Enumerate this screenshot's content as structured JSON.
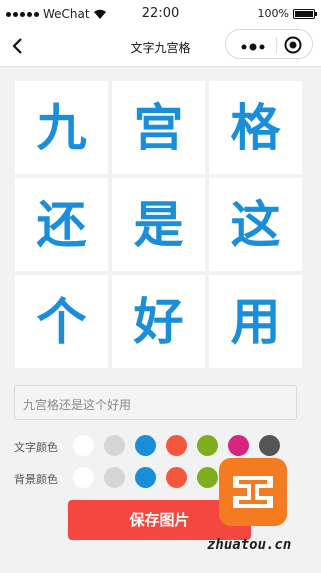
{
  "status_bar": {
    "carrier": "WeChat",
    "time": "22:00",
    "battery": "100%",
    "battery_level": 1.0
  },
  "nav": {
    "title": "文字九宫格",
    "back_icon": "chevron-left-icon",
    "more_icon": "more-dots-icon",
    "close_icon": "target-circle-icon"
  },
  "grid": {
    "text_color": "#1a8ed8",
    "cell_bg": "#ffffff",
    "cells": [
      "九",
      "宫",
      "格",
      "还",
      "是",
      "这",
      "个",
      "好",
      "用"
    ]
  },
  "input": {
    "placeholder": "九宫格还是这个好用"
  },
  "text_color_row": {
    "label": "文字颜色",
    "colors": [
      "#ffffff",
      "#d6d6d6",
      "#1a8ed8",
      "#f4573c",
      "#7fae1c",
      "#d6247f",
      "#555555"
    ]
  },
  "bg_color_row": {
    "label": "背景颜色",
    "colors": [
      "#ffffff",
      "#d6d6d6",
      "#1a8ed8",
      "#f4573c",
      "#7fae1c",
      "#d6247f",
      "#555555"
    ]
  },
  "save_button": {
    "label": "保存图片",
    "color": "#f4473f"
  },
  "watermark": {
    "text": "zhuatou.cn",
    "logo_color": "#f47b20"
  }
}
